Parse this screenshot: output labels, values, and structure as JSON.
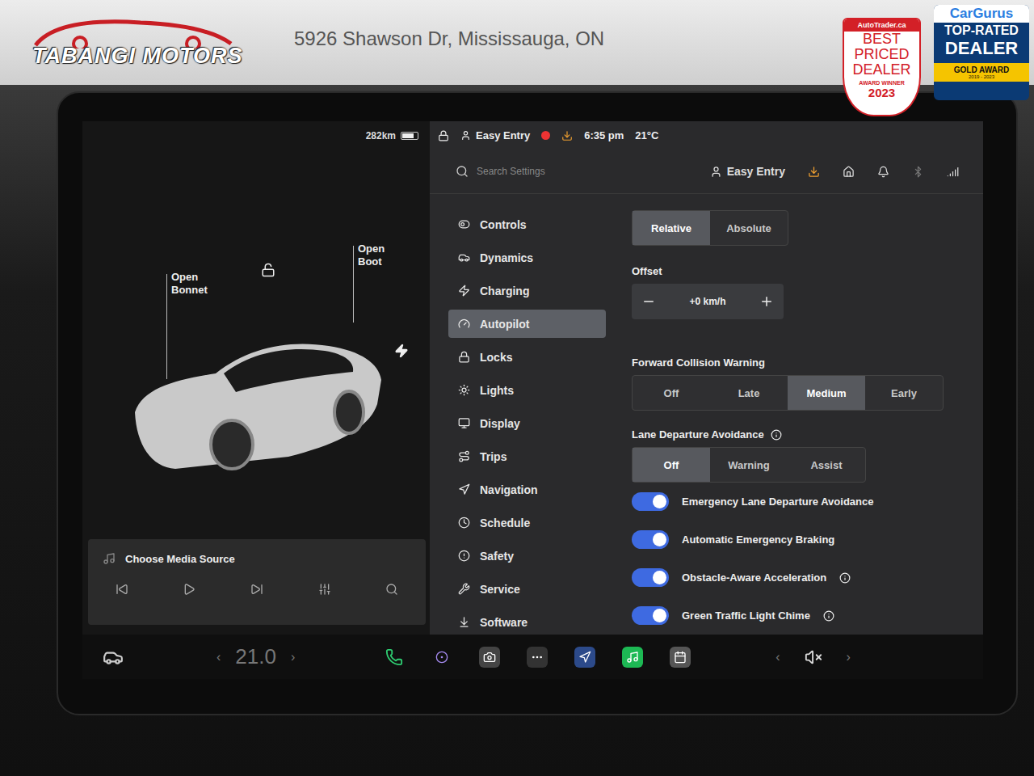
{
  "header": {
    "logo": "TABANGI MOTORS",
    "address": "5926 Shawson Dr, Mississauga, ON",
    "badges": [
      {
        "brand": "AutoTrader.ca",
        "lines": [
          "BEST",
          "PRICED",
          "DEALER"
        ],
        "note": "AWARD WINNER",
        "year": "2023"
      },
      {
        "brand": "CarGurus",
        "lines": [
          "TOP-RATED",
          "DEALER"
        ],
        "note": "GOLD AWARD",
        "year": "2019 - 2023"
      }
    ]
  },
  "car_panel": {
    "range": "282km",
    "battery_level": 0.8,
    "callouts": [
      {
        "lines": [
          "Open",
          "Bonnet"
        ]
      },
      {
        "lines": [
          "Open",
          "Boot"
        ]
      }
    ]
  },
  "media": {
    "source": "Choose Media Source"
  },
  "status_bar": {
    "profile": "Easy Entry",
    "time": "6:35 pm",
    "temperature": "21°C"
  },
  "settings": {
    "search_placeholder": "Search Settings",
    "profile": "Easy Entry",
    "menu": [
      {
        "label": "Controls",
        "selected": false
      },
      {
        "label": "Dynamics",
        "selected": false
      },
      {
        "label": "Charging",
        "selected": false
      },
      {
        "label": "Autopilot",
        "selected": true
      },
      {
        "label": "Locks",
        "selected": false
      },
      {
        "label": "Lights",
        "selected": false
      },
      {
        "label": "Display",
        "selected": false
      },
      {
        "label": "Trips",
        "selected": false
      },
      {
        "label": "Navigation",
        "selected": false
      },
      {
        "label": "Schedule",
        "selected": false
      },
      {
        "label": "Safety",
        "selected": false
      },
      {
        "label": "Service",
        "selected": false
      },
      {
        "label": "Software",
        "selected": false
      }
    ]
  },
  "autopilot": {
    "speed_mode": [
      {
        "label": "Relative",
        "selected": true
      },
      {
        "label": "Absolute",
        "selected": false
      }
    ],
    "offset": {
      "label": "Offset",
      "value": "+0 km/h"
    },
    "fcw": {
      "title": "Forward Collision Warning",
      "options": [
        {
          "label": "Off",
          "selected": false
        },
        {
          "label": "Late",
          "selected": false
        },
        {
          "label": "Medium",
          "selected": true
        },
        {
          "label": "Early",
          "selected": false
        }
      ]
    },
    "lda": {
      "title": "Lane Departure Avoidance",
      "info": true,
      "options": [
        {
          "label": "Off",
          "selected": true
        },
        {
          "label": "Warning",
          "selected": false
        },
        {
          "label": "Assist",
          "selected": false
        }
      ]
    },
    "toggles": [
      {
        "label": "Emergency Lane Departure Avoidance",
        "on": true,
        "info": false
      },
      {
        "label": "Automatic Emergency Braking",
        "on": true,
        "info": false
      },
      {
        "label": "Obstacle-Aware Acceleration",
        "on": true,
        "info": true
      },
      {
        "label": "Green Traffic Light Chime",
        "on": true,
        "info": true
      }
    ]
  },
  "dock": {
    "temperature": "21.0",
    "prev": "‹",
    "next": "›",
    "volume_prev": "‹",
    "volume_next": "›"
  }
}
